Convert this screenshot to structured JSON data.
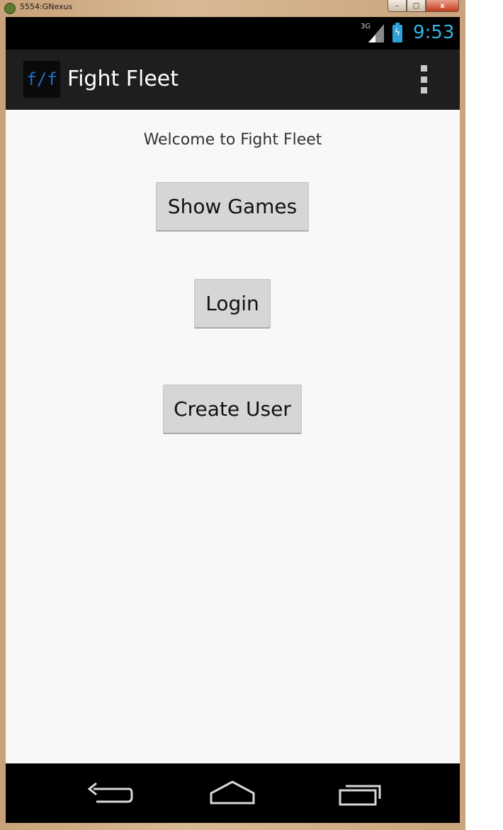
{
  "window": {
    "title": "5554:GNexus",
    "minimize": "–",
    "maximize": "□",
    "close": "x"
  },
  "status_bar": {
    "network": "3G",
    "time": "9:53",
    "accent_color": "#33b5e5"
  },
  "action_bar": {
    "logo_text": "f/f",
    "title": "Fight Fleet",
    "overflow_icon": "overflow-menu-icon"
  },
  "main": {
    "welcome_text": "Welcome to Fight Fleet",
    "buttons": {
      "show_games": "Show Games",
      "login": "Login",
      "create_user": "Create User"
    }
  },
  "nav_bar": {
    "back_icon": "back-icon",
    "home_icon": "home-icon",
    "recent_icon": "recent-apps-icon"
  }
}
